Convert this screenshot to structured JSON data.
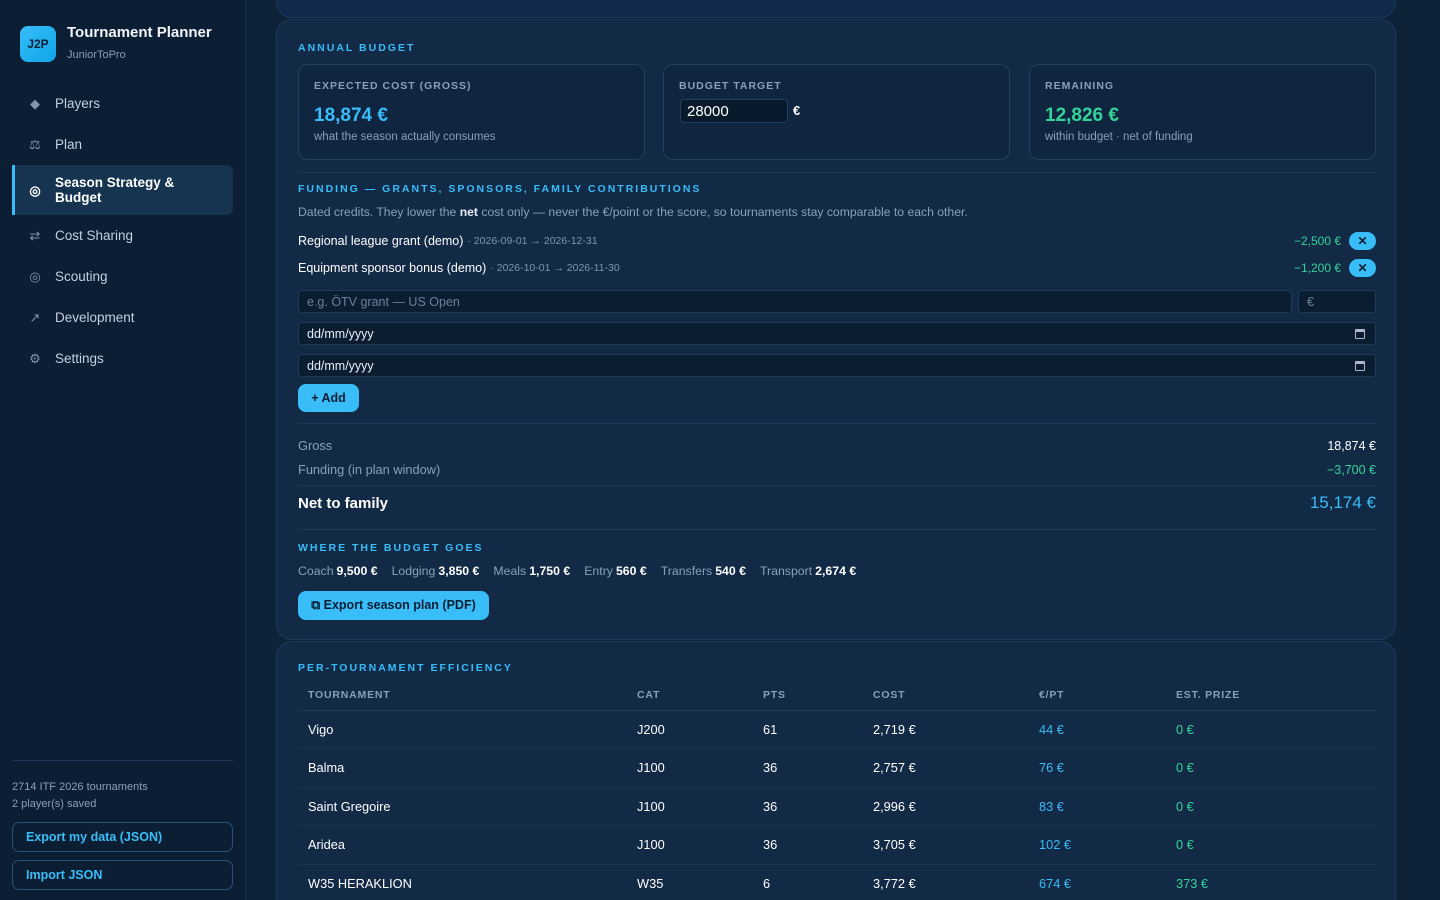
{
  "app": {
    "logo_text": "J2P",
    "title": "Tournament Planner",
    "subtitle": "JuniorToPro"
  },
  "nav": {
    "items": [
      {
        "icon": "diamond-icon",
        "glyph": "◆",
        "label": "Players"
      },
      {
        "icon": "scale-icon",
        "glyph": "⚖",
        "label": "Plan"
      },
      {
        "icon": "target-icon",
        "glyph": "◎",
        "label": "Season Strategy & Budget",
        "active": true
      },
      {
        "icon": "swap-icon",
        "glyph": "⇄",
        "label": "Cost Sharing"
      },
      {
        "icon": "scout-icon",
        "glyph": "◎",
        "label": "Scouting"
      },
      {
        "icon": "trend-icon",
        "glyph": "↗",
        "label": "Development"
      },
      {
        "icon": "gear-icon",
        "glyph": "⚙",
        "label": "Settings"
      }
    ]
  },
  "sidebar_footer": {
    "tournaments_count": "2714 ITF 2026 tournaments",
    "players_saved": "2 player(s) saved",
    "export_label": "Export my data (JSON)",
    "import_label": "Import JSON"
  },
  "annual_budget": {
    "title": "ANNUAL BUDGET",
    "expected": {
      "label": "EXPECTED COST (GROSS)",
      "value": "18,874 €",
      "note": "what the season actually consumes"
    },
    "target": {
      "label": "BUDGET TARGET",
      "value": "28000",
      "currency": "€"
    },
    "remaining": {
      "label": "REMAINING",
      "value": "12,826 €",
      "note": "within budget · net of funding"
    }
  },
  "funding": {
    "title": "FUNDING — GRANTS, SPONSORS, FAMILY CONTRIBUTIONS",
    "desc_before": "Dated credits. They lower the ",
    "desc_bold": "net",
    "desc_after": " cost only — never the €/point or the score, so tournaments stay comparable to each other.",
    "items": [
      {
        "name": "Regional league grant (demo)",
        "dates": "· 2026-09-01 → 2026-12-31",
        "amount": "−2,500 €"
      },
      {
        "name": "Equipment sponsor bonus (demo)",
        "dates": "· 2026-10-01 → 2026-11-30",
        "amount": "−1,200 €"
      }
    ],
    "delete_glyph": "✕",
    "name_placeholder": "e.g. ÖTV grant — US Open",
    "amount_placeholder": "€",
    "start_date": "dd/mm/yyyy",
    "end_date": "dd/mm/yyyy",
    "add_label": "+ Add"
  },
  "summary": {
    "gross_label": "Gross",
    "gross_value": "18,874 €",
    "funding_label": "Funding (in plan window)",
    "funding_value": "−3,700 €",
    "net_label": "Net to family",
    "net_value": "15,174 €"
  },
  "breakdown": {
    "title": "WHERE THE BUDGET GOES",
    "items": [
      {
        "label": "Coach",
        "value": "9,500 €"
      },
      {
        "label": "Lodging",
        "value": "3,850 €"
      },
      {
        "label": "Meals",
        "value": "1,750 €"
      },
      {
        "label": "Entry",
        "value": "560 €"
      },
      {
        "label": "Transfers",
        "value": "540 €"
      },
      {
        "label": "Transport",
        "value": "2,674 €"
      }
    ],
    "export_label": "⧉ Export season plan (PDF)"
  },
  "efficiency": {
    "title": "PER-TOURNAMENT EFFICIENCY",
    "columns": [
      "TOURNAMENT",
      "CAT",
      "PTS",
      "COST",
      "€/PT",
      "EST. PRIZE"
    ],
    "rows": [
      [
        "Vigo",
        "J200",
        "61",
        "2,719 €",
        "44 €",
        "0 €"
      ],
      [
        "Balma",
        "J100",
        "36",
        "2,757 €",
        "76 €",
        "0 €"
      ],
      [
        "Saint Gregoire",
        "J100",
        "36",
        "2,996 €",
        "83 €",
        "0 €"
      ],
      [
        "Aridea",
        "J100",
        "36",
        "3,705 €",
        "102 €",
        "0 €"
      ],
      [
        "W35 HERAKLION",
        "W35",
        "6",
        "3,772 €",
        "674 €",
        "373 €"
      ]
    ]
  }
}
